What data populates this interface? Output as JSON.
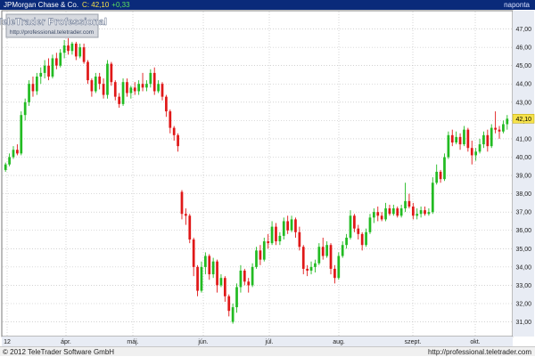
{
  "header": {
    "name": "JPMorgan Chase & Co.",
    "close_label": "C: 42,10",
    "change_label": "+0,33",
    "period": "naponta"
  },
  "logo": {
    "brand": "TeleTrader Professional",
    "url": "http://professional.teletrader.com"
  },
  "footer": {
    "copyright": "© 2012 TeleTrader Software GmbH",
    "url": "http://professional.teletrader.com"
  },
  "colors": {
    "up": "#22bb22",
    "down": "#e01818",
    "grid": "#b8b8b8",
    "plot_bg": "#ffffff",
    "axis_bg": "#e8ecf4",
    "last_price_bg": "#f6e24a"
  },
  "chart_data": {
    "type": "candlestick",
    "title": "JPMorgan Chase & Co.",
    "frequency": "naponta",
    "last_price_label": "42,10",
    "ylim": [
      30.2,
      48.0
    ],
    "y_ticks": [
      "31,00",
      "32,00",
      "33,00",
      "34,00",
      "35,00",
      "36,00",
      "37,00",
      "38,00",
      "39,00",
      "40,00",
      "41,00",
      "42,00",
      "43,00",
      "44,00",
      "45,00",
      "46,00",
      "47,00"
    ],
    "x_ticks": [
      "12",
      "ápr.",
      "máj.",
      "jún.",
      "júl.",
      "aug.",
      "szept.",
      "okt."
    ],
    "grid": true,
    "candles": [
      [
        39.3,
        39.7,
        39.2,
        39.6
      ],
      [
        39.6,
        40.2,
        39.5,
        40.0
      ],
      [
        40.0,
        40.6,
        39.9,
        40.4
      ],
      [
        40.4,
        40.7,
        40.1,
        40.2
      ],
      [
        40.2,
        42.5,
        40.1,
        42.3
      ],
      [
        42.3,
        43.2,
        42.0,
        43.0
      ],
      [
        43.0,
        44.2,
        42.8,
        44.0
      ],
      [
        44.0,
        44.4,
        43.3,
        43.6
      ],
      [
        43.6,
        44.6,
        43.4,
        44.4
      ],
      [
        44.4,
        44.9,
        44.0,
        44.6
      ],
      [
        44.6,
        45.3,
        44.3,
        45.0
      ],
      [
        45.0,
        45.4,
        44.2,
        44.4
      ],
      [
        44.4,
        45.6,
        44.3,
        45.4
      ],
      [
        45.4,
        45.7,
        44.8,
        45.0
      ],
      [
        45.0,
        45.9,
        44.9,
        45.7
      ],
      [
        45.7,
        46.4,
        45.4,
        46.1
      ],
      [
        46.1,
        46.5,
        45.6,
        45.8
      ],
      [
        45.8,
        46.3,
        45.6,
        46.2
      ],
      [
        46.2,
        46.3,
        45.3,
        45.5
      ],
      [
        45.5,
        46.2,
        45.4,
        46.0
      ],
      [
        46.0,
        46.2,
        45.1,
        45.2
      ],
      [
        45.2,
        45.3,
        44.0,
        44.2
      ],
      [
        44.2,
        44.3,
        43.3,
        43.6
      ],
      [
        43.6,
        44.6,
        43.5,
        44.4
      ],
      [
        44.4,
        44.6,
        43.7,
        44.0
      ],
      [
        44.0,
        44.3,
        43.2,
        43.4
      ],
      [
        43.4,
        45.3,
        43.2,
        45.1
      ],
      [
        45.1,
        45.2,
        43.9,
        44.1
      ],
      [
        44.1,
        44.2,
        43.1,
        43.3
      ],
      [
        43.3,
        43.5,
        42.7,
        42.9
      ],
      [
        42.9,
        44.3,
        42.8,
        44.1
      ],
      [
        44.1,
        44.3,
        43.3,
        43.5
      ],
      [
        43.5,
        43.9,
        43.2,
        43.8
      ],
      [
        43.8,
        44.1,
        43.4,
        43.6
      ],
      [
        43.6,
        44.2,
        43.4,
        44.0
      ],
      [
        44.0,
        44.6,
        43.6,
        43.8
      ],
      [
        43.8,
        44.2,
        43.6,
        44.0
      ],
      [
        44.0,
        44.8,
        43.8,
        44.6
      ],
      [
        44.6,
        44.9,
        43.4,
        43.6
      ],
      [
        43.6,
        44.2,
        43.5,
        44.0
      ],
      [
        44.0,
        44.1,
        43.1,
        43.3
      ],
      [
        43.3,
        43.4,
        42.2,
        42.5
      ],
      [
        42.5,
        42.6,
        41.3,
        41.6
      ],
      [
        41.6,
        41.7,
        40.9,
        41.2
      ],
      [
        41.2,
        41.3,
        40.3,
        40.6
      ],
      [
        38.1,
        38.2,
        36.6,
        36.9
      ],
      [
        36.9,
        37.2,
        36.3,
        36.8
      ],
      [
        36.8,
        36.9,
        35.3,
        35.5
      ],
      [
        35.5,
        35.6,
        33.5,
        34.0
      ],
      [
        34.0,
        34.1,
        32.4,
        32.7
      ],
      [
        32.7,
        34.3,
        32.6,
        34.0
      ],
      [
        34.0,
        34.8,
        33.6,
        34.6
      ],
      [
        34.6,
        34.7,
        33.3,
        33.6
      ],
      [
        33.6,
        34.5,
        33.4,
        34.3
      ],
      [
        34.3,
        34.4,
        32.6,
        33.0
      ],
      [
        33.0,
        33.6,
        32.9,
        33.4
      ],
      [
        33.4,
        33.5,
        32.1,
        32.4
      ],
      [
        32.4,
        32.5,
        31.3,
        31.6
      ],
      [
        31.0,
        32.0,
        30.9,
        31.8
      ],
      [
        31.8,
        33.1,
        31.5,
        32.9
      ],
      [
        32.9,
        34.1,
        32.6,
        33.8
      ],
      [
        33.8,
        33.9,
        33.0,
        33.2
      ],
      [
        33.2,
        33.4,
        32.6,
        33.0
      ],
      [
        33.0,
        34.2,
        32.9,
        34.0
      ],
      [
        34.0,
        35.1,
        33.9,
        34.9
      ],
      [
        34.9,
        35.2,
        34.1,
        34.4
      ],
      [
        34.4,
        35.6,
        34.3,
        35.4
      ],
      [
        35.4,
        35.8,
        35.0,
        35.3
      ],
      [
        35.3,
        36.5,
        35.2,
        36.2
      ],
      [
        36.2,
        36.4,
        35.2,
        35.4
      ],
      [
        35.4,
        35.9,
        35.2,
        35.7
      ],
      [
        35.7,
        36.7,
        35.5,
        36.5
      ],
      [
        36.5,
        36.8,
        35.8,
        36.0
      ],
      [
        36.0,
        36.8,
        35.9,
        36.6
      ],
      [
        36.6,
        36.7,
        35.6,
        35.9
      ],
      [
        35.9,
        36.2,
        34.9,
        35.1
      ],
      [
        35.1,
        35.2,
        33.6,
        33.9
      ],
      [
        33.9,
        34.1,
        33.5,
        33.8
      ],
      [
        33.8,
        34.3,
        33.6,
        34.0
      ],
      [
        34.0,
        34.4,
        33.7,
        34.2
      ],
      [
        34.2,
        35.3,
        34.1,
        35.1
      ],
      [
        35.1,
        35.6,
        34.4,
        34.6
      ],
      [
        34.6,
        35.4,
        34.5,
        35.2
      ],
      [
        35.2,
        35.3,
        33.6,
        33.9
      ],
      [
        33.9,
        34.1,
        33.1,
        33.4
      ],
      [
        33.4,
        34.8,
        33.3,
        34.6
      ],
      [
        34.6,
        35.4,
        34.5,
        35.2
      ],
      [
        35.2,
        35.8,
        35.0,
        35.6
      ],
      [
        35.6,
        37.1,
        35.5,
        36.8
      ],
      [
        36.8,
        36.9,
        35.9,
        36.1
      ],
      [
        36.1,
        36.3,
        35.5,
        35.8
      ],
      [
        35.8,
        35.9,
        34.9,
        35.2
      ],
      [
        35.2,
        36.1,
        35.1,
        35.9
      ],
      [
        35.9,
        36.9,
        35.8,
        36.7
      ],
      [
        36.7,
        37.2,
        36.4,
        37.0
      ],
      [
        37.0,
        37.3,
        36.5,
        36.8
      ],
      [
        36.8,
        37.0,
        36.5,
        36.6
      ],
      [
        36.6,
        37.5,
        36.5,
        37.2
      ],
      [
        37.2,
        37.4,
        36.8,
        36.9
      ],
      [
        36.9,
        37.4,
        36.8,
        37.2
      ],
      [
        37.2,
        37.3,
        36.7,
        36.8
      ],
      [
        36.8,
        37.4,
        36.7,
        37.2
      ],
      [
        37.2,
        38.6,
        37.0,
        37.6
      ],
      [
        37.6,
        38.0,
        37.2,
        37.3
      ],
      [
        37.3,
        37.5,
        36.6,
        36.8
      ],
      [
        36.8,
        37.2,
        36.6,
        36.9
      ],
      [
        36.9,
        37.3,
        36.7,
        37.1
      ],
      [
        37.1,
        37.3,
        36.8,
        36.9
      ],
      [
        36.9,
        37.2,
        36.8,
        37.0
      ],
      [
        37.0,
        38.9,
        36.9,
        38.6
      ],
      [
        38.6,
        39.6,
        38.5,
        39.2
      ],
      [
        39.2,
        39.3,
        38.6,
        38.8
      ],
      [
        38.8,
        40.2,
        38.7,
        40.0
      ],
      [
        40.0,
        41.4,
        39.9,
        41.2
      ],
      [
        41.2,
        41.5,
        40.6,
        40.8
      ],
      [
        40.8,
        41.4,
        40.7,
        41.1
      ],
      [
        41.1,
        41.3,
        40.4,
        40.7
      ],
      [
        40.7,
        41.7,
        40.6,
        41.5
      ],
      [
        41.5,
        41.6,
        40.3,
        40.5
      ],
      [
        40.5,
        40.9,
        39.6,
        40.1
      ],
      [
        40.1,
        40.5,
        39.8,
        40.3
      ],
      [
        40.3,
        41.0,
        40.2,
        40.7
      ],
      [
        40.7,
        41.4,
        40.5,
        41.2
      ],
      [
        41.2,
        41.5,
        40.3,
        40.6
      ],
      [
        40.6,
        41.8,
        40.5,
        41.6
      ],
      [
        41.6,
        42.5,
        41.3,
        41.5
      ],
      [
        41.5,
        41.7,
        41.0,
        41.4
      ],
      [
        41.4,
        42.0,
        41.3,
        41.8
      ],
      [
        41.8,
        42.3,
        41.5,
        42.1
      ]
    ]
  }
}
